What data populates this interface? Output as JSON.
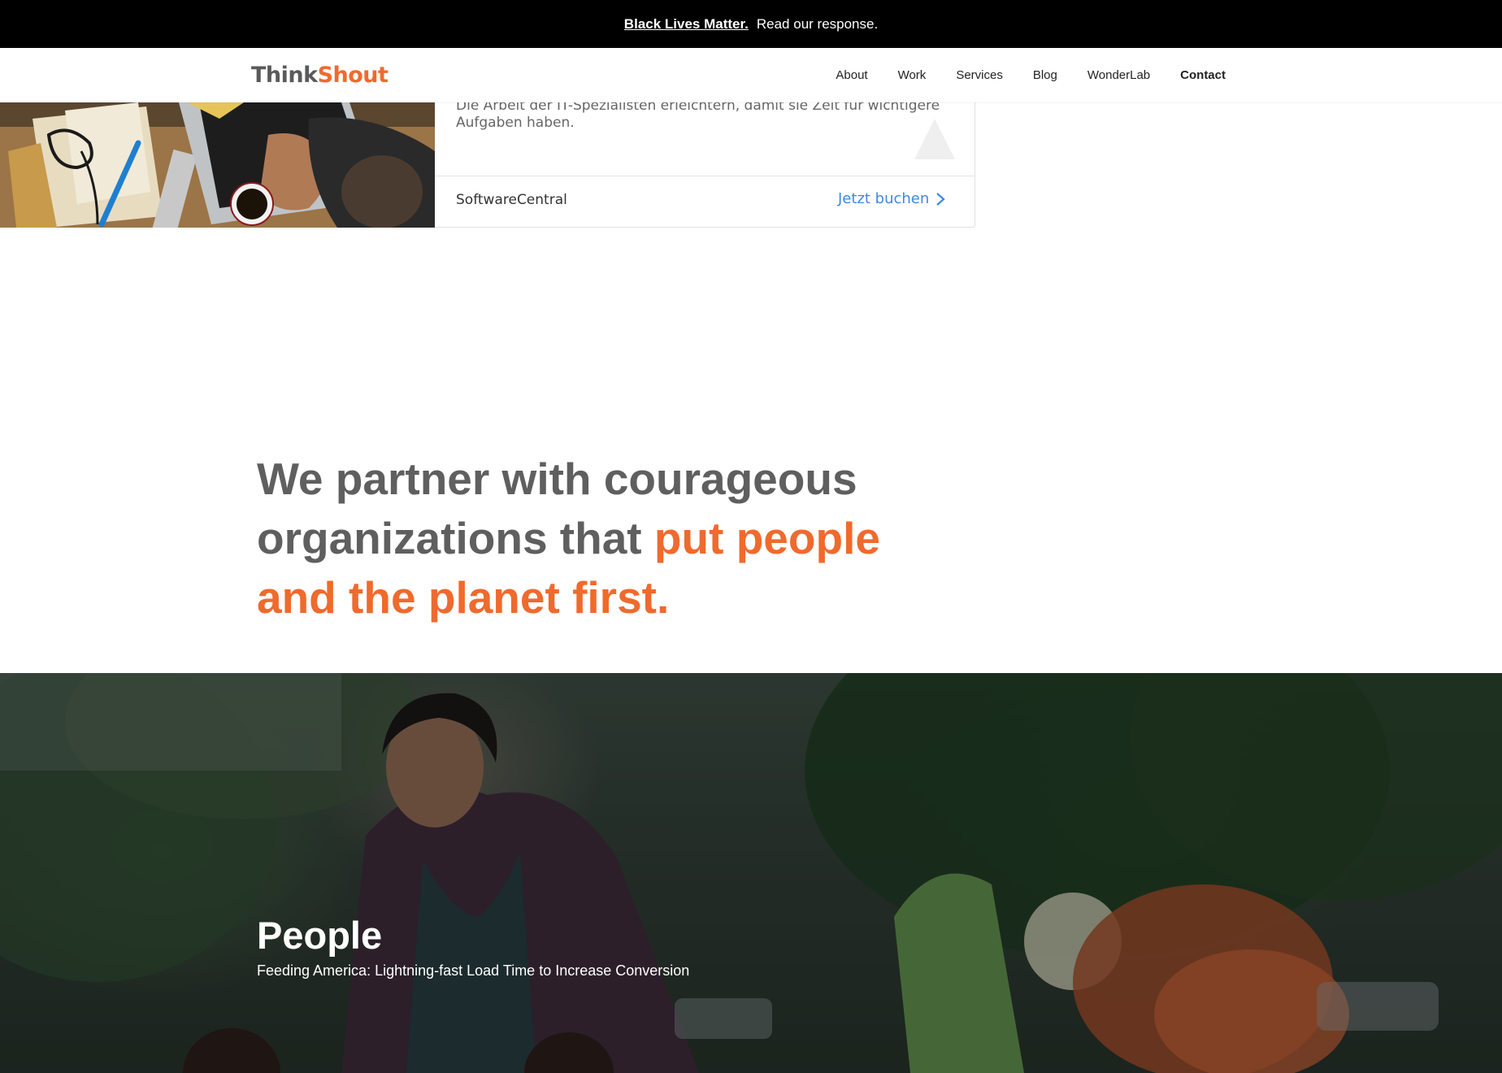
{
  "announcement": {
    "link_text": "Black Lives Matter.",
    "text": "Read our response."
  },
  "header": {
    "logo_think": "Think",
    "logo_shout": "Shout",
    "nav": [
      {
        "label": "About"
      },
      {
        "label": "Work"
      },
      {
        "label": "Services"
      },
      {
        "label": "Blog"
      },
      {
        "label": "WonderLab"
      },
      {
        "label": "Contact"
      }
    ]
  },
  "ad": {
    "description": "Die Arbeit der IT-Spezialisten erleichtern, damit sie Zeit für wichtigere Aufgaben haben.",
    "brand": "SoftwareCentral",
    "cta": "Jetzt buchen"
  },
  "headline": {
    "part1": "We partner with courageous organizations that ",
    "accent": "put people and the planet first."
  },
  "hero": {
    "title": "People",
    "subtitle": "Feeding America: Lightning-fast Load Time to Increase Conversion"
  },
  "colors": {
    "accent": "#ef6a2d",
    "link_blue": "#3c8ae6",
    "heading_gray": "#5f5f5f"
  }
}
